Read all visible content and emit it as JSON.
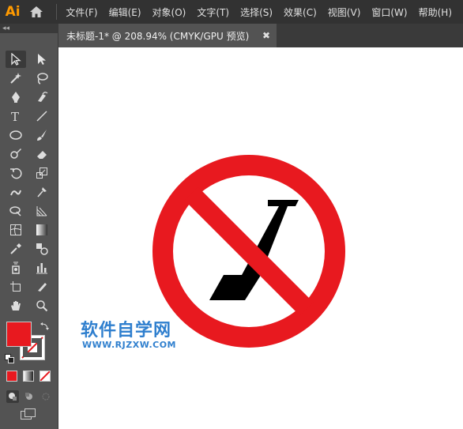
{
  "app": {
    "logo": "Ai"
  },
  "menu": [
    "文件(F)",
    "编辑(E)",
    "对象(O)",
    "文字(T)",
    "选择(S)",
    "效果(C)",
    "视图(V)",
    "窗口(W)",
    "帮助(H)"
  ],
  "document": {
    "tab_title": "未标题-1* @ 208.94% (CMYK/GPU 预览)",
    "close_glyph": "✖"
  },
  "toolpanel": {
    "collapse_glyph": "◂◂"
  },
  "colors": {
    "fill": "#e8191f",
    "stroke": "none",
    "sign_red": "#e8191f",
    "sign_black": "#000000",
    "watermark": "#2f7fce"
  },
  "watermark": {
    "text": "软件自学网",
    "url": "WWW.RJZXW.COM"
  }
}
